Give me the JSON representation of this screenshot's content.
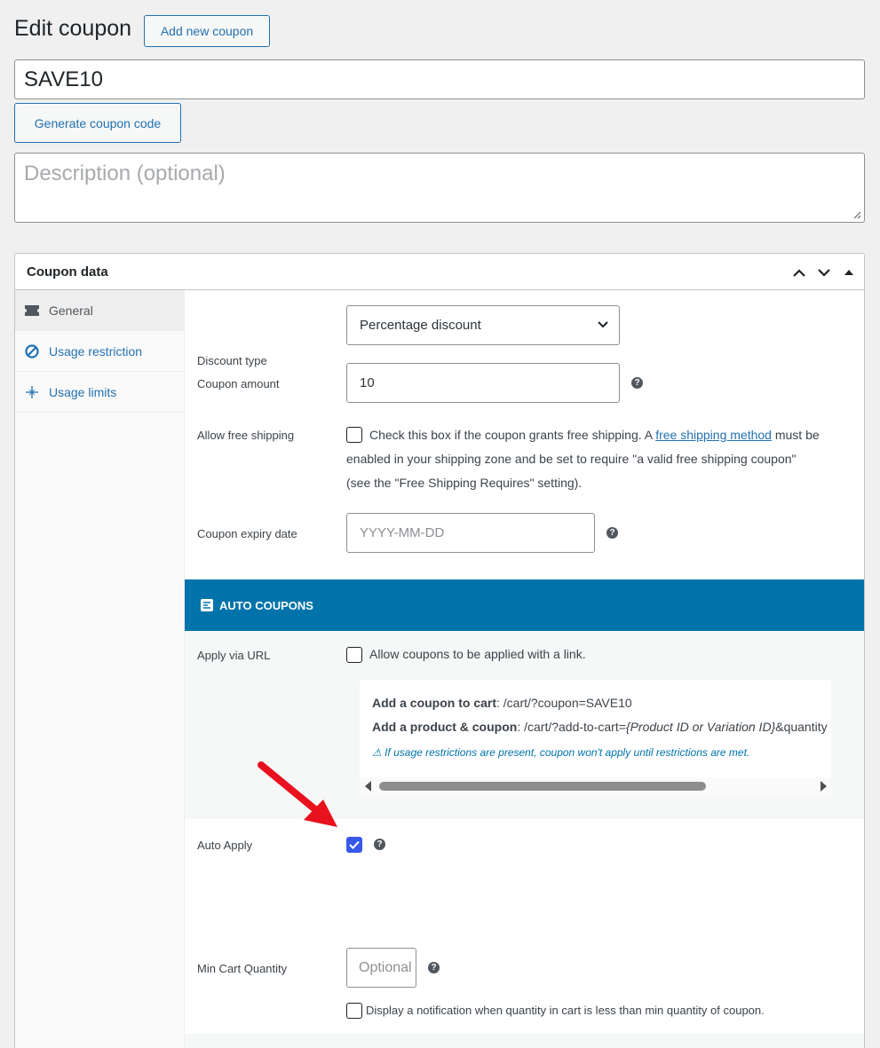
{
  "page": {
    "title": "Edit coupon",
    "add_new_label": "Add new coupon",
    "coupon_code": "SAVE10",
    "generate_label": "Generate coupon code",
    "description_placeholder": "Description (optional)"
  },
  "postbox": {
    "title": "Coupon data"
  },
  "tabs": [
    {
      "label": "General",
      "icon": "ticket-icon"
    },
    {
      "label": "Usage restriction",
      "icon": "no-entry-icon"
    },
    {
      "label": "Usage limits",
      "icon": "sparkle-icon"
    }
  ],
  "general": {
    "discount_type_label": "Discount type",
    "discount_type_value": "Percentage discount",
    "coupon_amount_label": "Coupon amount",
    "coupon_amount_value": "10",
    "free_shipping_label": "Allow free shipping",
    "free_shipping_text_1": "Check this box if the coupon grants free shipping. A",
    "free_shipping_link": "free shipping method",
    "free_shipping_text_2": "must be",
    "free_shipping_text_3": "enabled in your shipping zone and be set to require \"a valid free shipping coupon\"",
    "free_shipping_text_4": "(see the \"Free Shipping Requires\" setting).",
    "free_shipping_checked": false,
    "expiry_label": "Coupon expiry date",
    "expiry_placeholder": "YYYY-MM-DD"
  },
  "auto_coupons": {
    "heading": "AUTO COUPONS",
    "apply_url_label": "Apply via URL",
    "apply_url_text": "Allow coupons to be applied with a link.",
    "apply_url_checked": false,
    "add_coupon_bold": "Add a coupon to cart",
    "add_coupon_path": ": /cart/?coupon=SAVE10",
    "add_product_bold": "Add a product & coupon",
    "add_product_path_1": ": /cart/?add-to-cart=",
    "add_product_path_italic": "{Product ID or Variation ID}",
    "add_product_path_2": "&quantity",
    "restriction_note": "⚠ If usage restrictions are present, coupon won't apply until restrictions are met.",
    "auto_apply_label": "Auto Apply",
    "auto_apply_checked": true,
    "min_cart_label": "Min Cart Quantity",
    "min_cart_placeholder": "Optional",
    "min_cart_notify_text": "Display a notification when quantity in cart is less than min quantity of coupon.",
    "min_cart_notify_checked": false
  },
  "colors": {
    "accent": "#2271b1",
    "auto_coupons_header": "#0073aa",
    "checkbox_checked": "#3858e9",
    "arrow": "#e8111d"
  }
}
